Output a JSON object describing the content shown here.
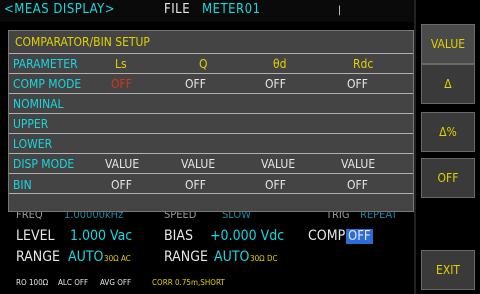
{
  "header": {
    "mode": "<MEAS DISPLAY>",
    "file_label": "FILE",
    "file_name": "METER01",
    "indicator": "|"
  },
  "dialog": {
    "title": "COMPARATOR/BIN SETUP",
    "rows": {
      "parameter": {
        "label": "PARAMETER",
        "values": [
          "Ls",
          "Q",
          "θd",
          "Rdc"
        ]
      },
      "comp_mode": {
        "label": "COMP MODE",
        "values": [
          "OFF",
          "OFF",
          "OFF",
          "OFF"
        ]
      },
      "nominal": {
        "label": "NOMINAL"
      },
      "upper": {
        "label": "UPPER"
      },
      "lower": {
        "label": "LOWER"
      },
      "disp_mode": {
        "label": "DISP MODE",
        "values": [
          "VALUE",
          "VALUE",
          "VALUE",
          "VALUE"
        ]
      },
      "bin": {
        "label": "BIN",
        "values": [
          "OFF",
          "OFF",
          "OFF",
          "OFF"
        ]
      }
    }
  },
  "status": {
    "freq_label": "FREQ",
    "freq_value": "1.00000kHz",
    "speed_label": "SPEED",
    "speed_value": "SLOW",
    "trig_label": "TRIG",
    "trig_value": "REPEAT",
    "level_label": "LEVEL",
    "level_value": "1.000 Vac",
    "bias_label": "BIAS",
    "bias_value": "+0.000 Vdc",
    "comp_label": "COMP",
    "comp_value": "OFF",
    "range1_label": "RANGE",
    "range1_value": "AUTO",
    "range1_sub": "30Ω AC",
    "range2_label": "RANGE",
    "range2_value": "AUTO",
    "range2_sub": "30Ω DC",
    "footer_ro": "RO 100Ω",
    "footer_alc": "ALC OFF",
    "footer_avg": "AVG OFF",
    "footer_corr": "CORR 0.75m,SHORT"
  },
  "softkeys": {
    "value": "VALUE",
    "delta": "Δ",
    "delta_pct": "Δ%",
    "off": "OFF",
    "exit": "EXIT"
  },
  "colors": {
    "accent_yellow": "#e2d200",
    "accent_cyan": "#19d7e0",
    "warning_red": "#d8321c",
    "highlight_blue": "#2a6cd8",
    "dialog_gray": "#444444"
  }
}
